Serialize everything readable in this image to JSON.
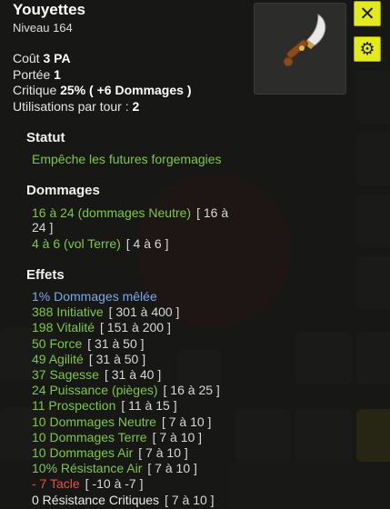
{
  "item": {
    "name": "Youyettes",
    "level": "Niveau  164"
  },
  "stats": {
    "cost_label": "Coût",
    "cost_value": "3 PA",
    "range_label": "Portée",
    "range_value": "1",
    "crit_label": "Critique",
    "crit_value": "25% ( +6 Dommages )",
    "uses_label": "Utilisations par tour :",
    "uses_value": "2"
  },
  "statut": {
    "title": "Statut",
    "text": "Empêche les futures forgemagies"
  },
  "dommages": {
    "title": "Dommages",
    "lines": [
      {
        "text": "16 à 24 (dommages Neutre)",
        "range": "[ 16 à",
        "cont": "24 ]"
      },
      {
        "text": "4 à 6 (vol Terre)",
        "range": "[ 4 à 6 ]"
      }
    ]
  },
  "effets": {
    "title": "Effets",
    "lines": [
      {
        "text": "1% Dommages mêlée",
        "range": "",
        "color": "#7fa6e8"
      },
      {
        "text": "388 Initiative",
        "range": "[ 301 à 400 ]",
        "color": "#80c640"
      },
      {
        "text": "198 Vitalité",
        "range": "[ 151 à 200 ]",
        "color": "#80c640"
      },
      {
        "text": "50 Force",
        "range": "[ 31 à 50 ]",
        "color": "#80c640"
      },
      {
        "text": "49 Agilité",
        "range": "[ 31 à 50 ]",
        "color": "#80c640"
      },
      {
        "text": "37 Sagesse",
        "range": "[ 31 à 40 ]",
        "color": "#80c640"
      },
      {
        "text": "24 Puissance (pièges)",
        "range": "[ 16 à 25 ]",
        "color": "#80c640"
      },
      {
        "text": "11 Prospection",
        "range": "[ 11 à 15 ]",
        "color": "#80c640"
      },
      {
        "text": "10 Dommages Neutre",
        "range": "[ 7 à 10 ]",
        "color": "#80c640"
      },
      {
        "text": "10 Dommages Terre",
        "range": "[ 7 à 10 ]",
        "color": "#80c640"
      },
      {
        "text": "10 Dommages Air",
        "range": "[ 7 à 10 ]",
        "color": "#80c640"
      },
      {
        "text": "10% Résistance Air",
        "range": "[ 7 à 10 ]",
        "color": "#80c640"
      },
      {
        "text": "- 7 Tacle",
        "range": "[ -10 à -7 ]",
        "color": "#e0543f"
      },
      {
        "text": "0 Résistance Critiques",
        "range": "[ 7 à 10 ]",
        "color": "#e8e8e8"
      }
    ]
  },
  "buttons": {
    "close_icon": "✕",
    "settings_icon": "⚙"
  },
  "colors": {
    "accent": "#e3ea1e",
    "positive": "#80c640",
    "negative": "#e0543f",
    "special": "#7fa6e8"
  }
}
